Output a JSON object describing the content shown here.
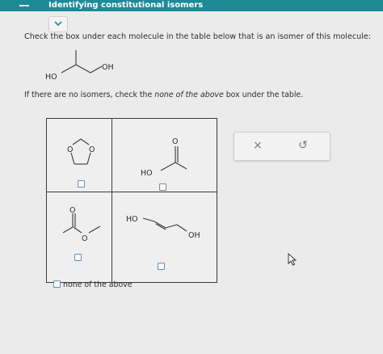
{
  "header": {
    "title": "Identifying constitutional isomers",
    "accent_color": "#1d8a97"
  },
  "question": {
    "prompt": "Check the box under each molecule in the table below that is an isomer of this molecule:",
    "hint_before": "If there are no isomers, check the ",
    "hint_em": "none of the above",
    "hint_after": " box under the table."
  },
  "reference_molecule": {
    "labels": {
      "ho": "HO",
      "oh": "OH"
    }
  },
  "table": {
    "cells": [
      {
        "name": "dioxolane",
        "labels": {
          "o_left": "O",
          "o_right": "O"
        },
        "checked": false
      },
      {
        "name": "hydroxy-ketone",
        "labels": {
          "o_top": "O",
          "ho": "HO"
        },
        "checked": false
      },
      {
        "name": "methyl-ester",
        "labels": {
          "o_top": "O",
          "o_mid": "O"
        },
        "checked": false
      },
      {
        "name": "butenediol",
        "labels": {
          "ho": "HO",
          "oh": "OH"
        },
        "checked": false
      }
    ]
  },
  "none_option": {
    "label": "none of the above",
    "checked": false
  },
  "tools": {
    "clear_icon": "x-icon",
    "clear_glyph": "×",
    "undo_icon": "undo-icon",
    "undo_glyph": "↺"
  }
}
